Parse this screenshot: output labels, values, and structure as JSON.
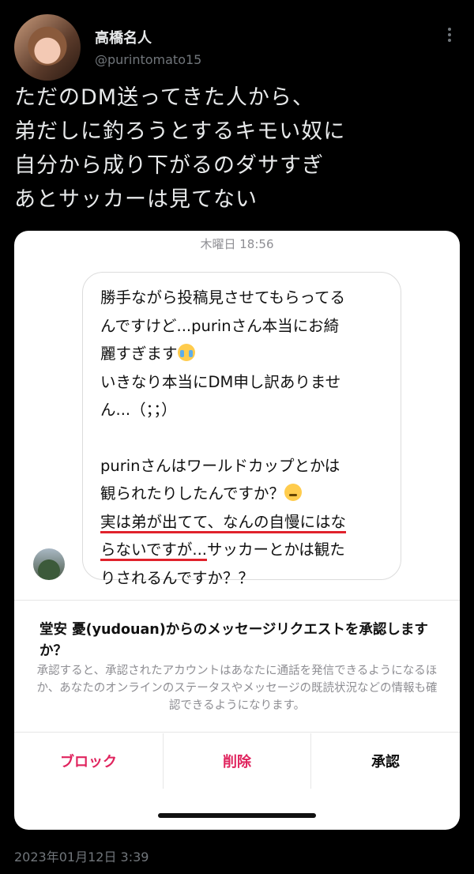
{
  "tweet": {
    "display_name": "高橋名人",
    "handle": "@purintomato15",
    "text_lines": [
      "ただのDM送ってきた人から、",
      "弟だしに釣ろうとするキモい奴に",
      "自分から成り下がるのダサすぎ",
      "あとサッカーは見てない"
    ],
    "date": "2023年01月12日 3:39"
  },
  "dm": {
    "timestamp": "木曜日 18:56",
    "message_lines": [
      "勝手ながら投稿見させてもらってる",
      "んですけど...purinさん本当にお綺",
      "麗すぎます",
      "いきなり本当にDM申し訳ありませ",
      "ん...（；；）",
      "purinさんはワールドカップとかは",
      "観られたりしたんですか？",
      "実は弟が出てて、なんの自慢にはな",
      "らないですが...",
      "サッカーとかは観た",
      "りされるんですか？？"
    ],
    "emoji": [
      "loudly-crying-face",
      "thinking-face"
    ],
    "underline_color": "#e0222c"
  },
  "request": {
    "title": "堂安 憂(yudouan)からのメッセージリクエストを承認しますか？",
    "description": "承認すると、承認されたアカウントはあなたに通話を発信できるようになるほか、あなたのオンラインのステータスやメッセージの既読状況などの情報も確認できるようになります。",
    "buttons": {
      "block": "ブロック",
      "delete": "削除",
      "accept": "承認"
    },
    "accent_color": "#e0245e"
  },
  "icons": [
    "more-icon",
    "avatar",
    "sender-avatar"
  ]
}
